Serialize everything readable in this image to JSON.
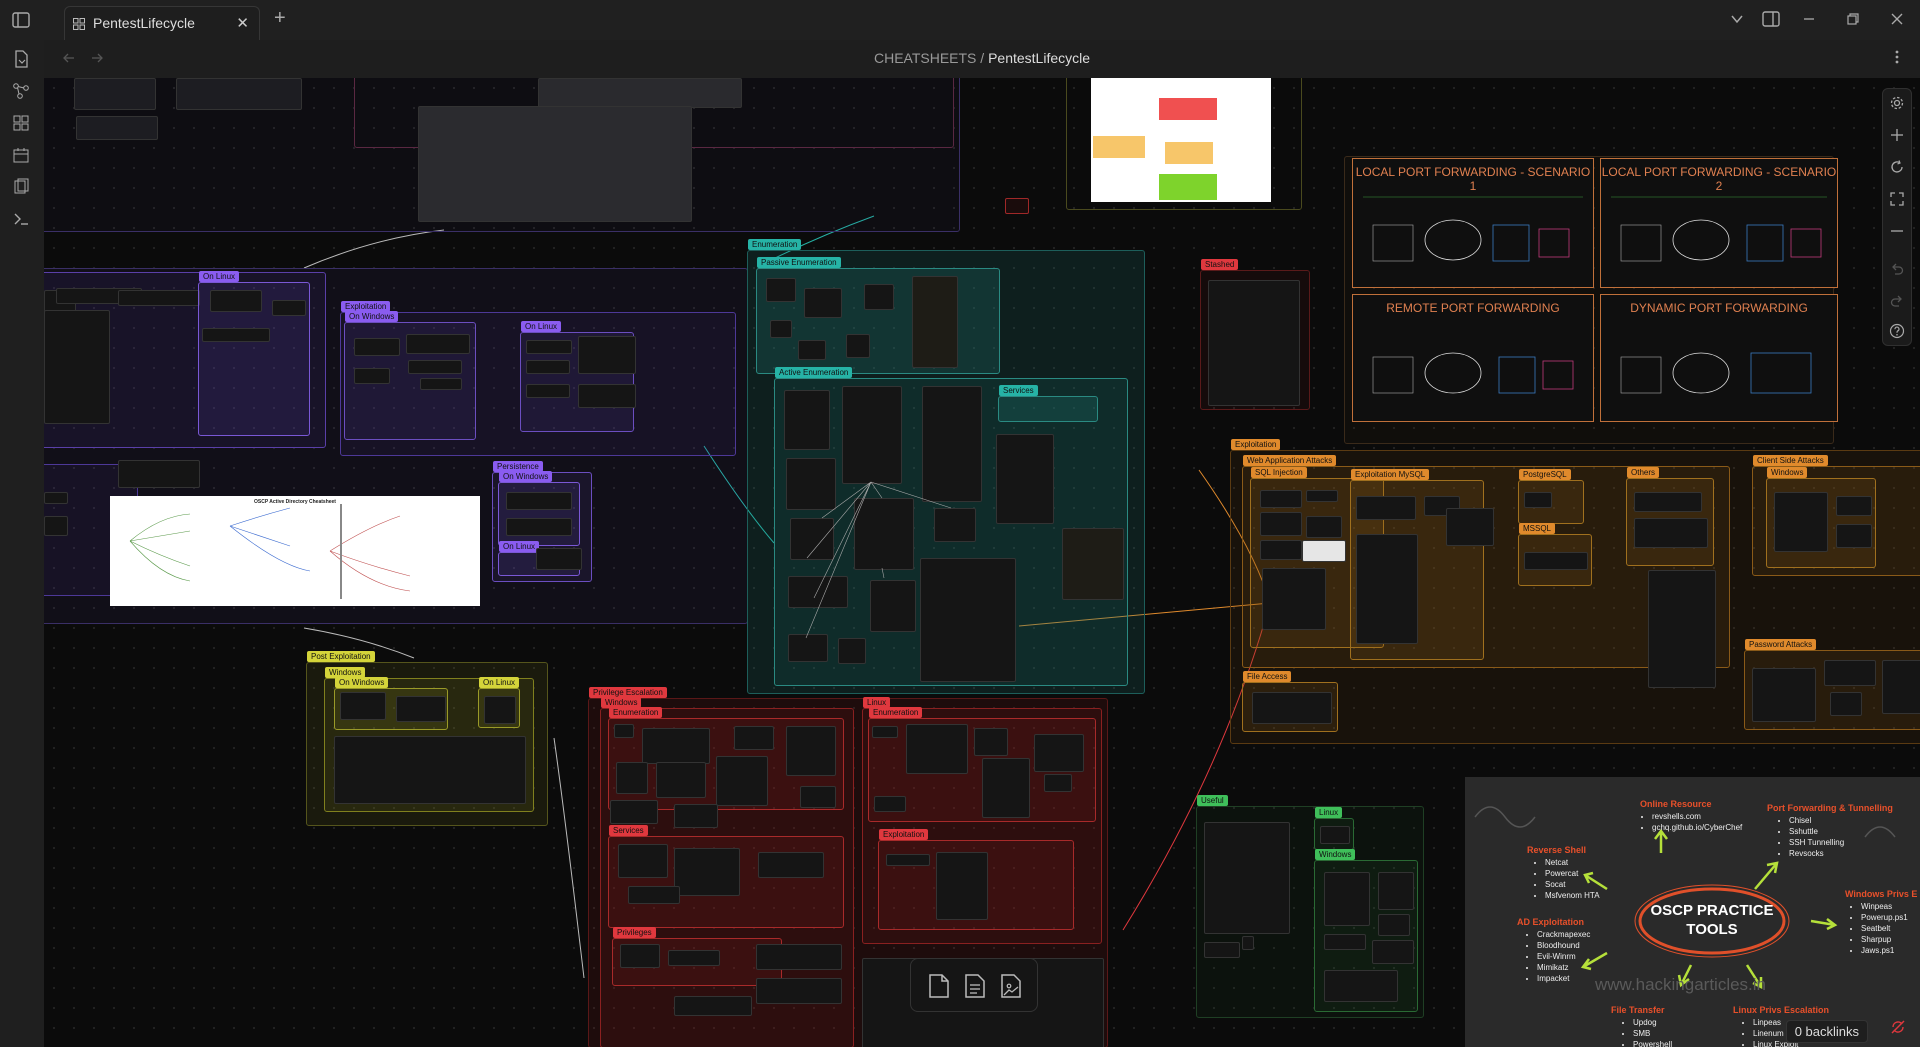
{
  "window": {
    "tab_title": "PentestLifecycle",
    "new_tab": "+",
    "close_tab": "✕"
  },
  "breadcrumb": {
    "folder": "CHEATSHEETS",
    "separator": "/",
    "file": "PentestLifecycle"
  },
  "canvas": {
    "groups": {
      "enumeration": "Enumeration",
      "passive": "Passive Enumeration",
      "active": "Active Enumeration",
      "services": "Services",
      "stashed": "Stashed",
      "exploitation_left": "Exploitation",
      "on_windows": "On Windows",
      "on_linux": "On Linux",
      "persistence": "Persistence",
      "post_exploitation": "Post Exploitation",
      "windows": "Windows",
      "privesc": "Privilege Escalation",
      "enumeration2": "Enumeration",
      "linux": "Linux",
      "services2": "Services",
      "privileges": "Privileges",
      "exploitation_red": "Exploitation",
      "exploitation_right": "Exploitation",
      "web_attacks": "Web Application Attacks",
      "sql_injection": "SQL Injection",
      "exploitation_mysql": "Exploitation MySQL",
      "postgresql": "PostgreSQL",
      "mssql": "MSSQL",
      "others": "Others",
      "client_side": "Client Side Attacks",
      "windows2": "Windows",
      "file_access": "File Access",
      "password_attacks": "Password Attacks",
      "useful": "Useful",
      "linux2": "Linux",
      "windows3": "Windows"
    },
    "port_forwarding": {
      "local1": "LOCAL PORT FORWARDING - SCENARIO 1",
      "local2": "LOCAL PORT FORWARDING - SCENARIO 2",
      "remote": "REMOTE PORT FORWARDING",
      "dynamic": "DYNAMIC PORT FORWARDING"
    },
    "ad_cheatsheet_title": "OSCP Active Directory Cheatsheet"
  },
  "oscp": {
    "title_line1": "OSCP PRACTICE",
    "title_line2": "TOOLS",
    "watermark": "www.hackingarticles.in",
    "online": {
      "title": "Online Resource",
      "items": [
        "revshells.com",
        "gchq.github.io/CyberChef"
      ]
    },
    "portfwd": {
      "title": "Port Forwarding & Tunnelling",
      "items": [
        "Chisel",
        "Sshuttle",
        "SSH Tunnelling",
        "Revsocks"
      ]
    },
    "revshell": {
      "title": "Reverse Shell",
      "items": [
        "Netcat",
        "Powercat",
        "Socat",
        "Msfvenom HTA"
      ]
    },
    "winpriv": {
      "title": "Windows Privs E",
      "items": [
        "Winpeas",
        "Powerup.ps1",
        "Seatbelt",
        "Sharpup",
        "Jaws.ps1"
      ]
    },
    "ad": {
      "title": "AD Exploitation",
      "items": [
        "Crackmapexec",
        "Bloodhound",
        "Evil-Winrm",
        "Mimikatz",
        "Impacket"
      ]
    },
    "transfer": {
      "title": "File Transfer",
      "items": [
        "Updog",
        "SMB",
        "Powershell"
      ]
    },
    "linpriv": {
      "title": "Linux Privs Escalation",
      "items": [
        "Linpeas",
        "Linenum",
        "Linux Exploit"
      ]
    }
  },
  "status": {
    "backlinks": "0 backlinks"
  },
  "colors": {
    "purple": "#8a5cf0",
    "teal": "#26b3a6",
    "red": "#e0383e",
    "orange": "#e08a2c",
    "yellow": "#d4d43a",
    "green": "#3fbf5a"
  }
}
